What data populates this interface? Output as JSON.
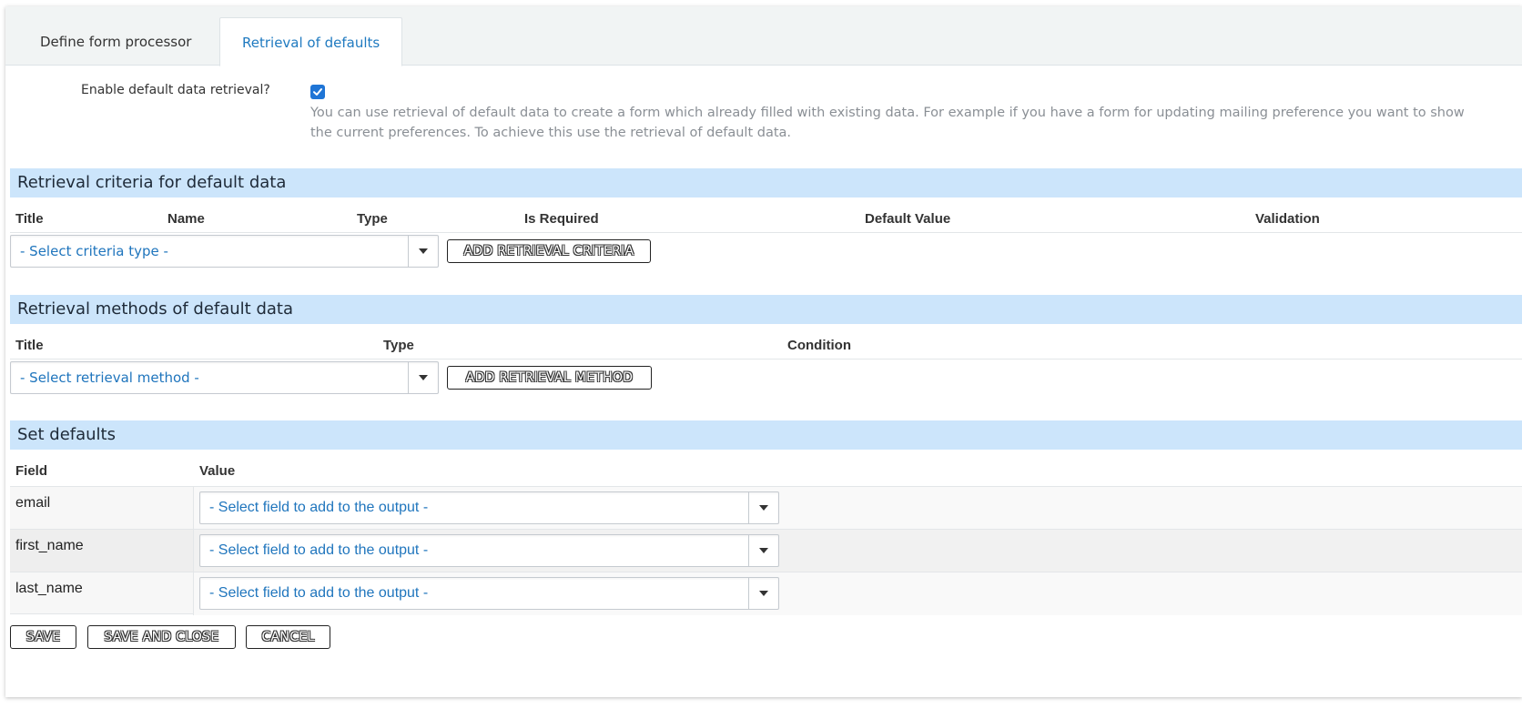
{
  "tabs": [
    {
      "label": "Define form processor"
    },
    {
      "label": "Retrieval of defaults"
    }
  ],
  "enable": {
    "label": "Enable default data retrieval?",
    "checked": true,
    "help_line1": "You can use retrieval of default data to create a form which already filled with existing data. For example if you have a form for updating mailing preference you want to show",
    "help_line2": "the current preferences. To achieve this use the retrieval of default data."
  },
  "criteria": {
    "title": "Retrieval criteria for default data",
    "columns": [
      "Title",
      "Name",
      "Type",
      "Is Required",
      "Default Value",
      "Validation"
    ],
    "select_placeholder": "- Select criteria type -",
    "add_button": "ADD RETRIEVAL CRITERIA"
  },
  "methods": {
    "title": "Retrieval methods of default data",
    "columns": [
      "Title",
      "Type",
      "Condition"
    ],
    "select_placeholder": "- Select retrieval method -",
    "add_button": "ADD RETRIEVAL METHOD"
  },
  "defaults": {
    "title": "Set defaults",
    "columns": [
      "Field",
      "Value"
    ],
    "rows": [
      {
        "field": "email",
        "value": "- Select field to add to the output -"
      },
      {
        "field": "first_name",
        "value": "- Select field to add to the output -"
      },
      {
        "field": "last_name",
        "value": "- Select field to add to the output -"
      }
    ]
  },
  "footer": {
    "save": "SAVE",
    "save_close": "SAVE AND CLOSE",
    "cancel": "CANCEL"
  }
}
